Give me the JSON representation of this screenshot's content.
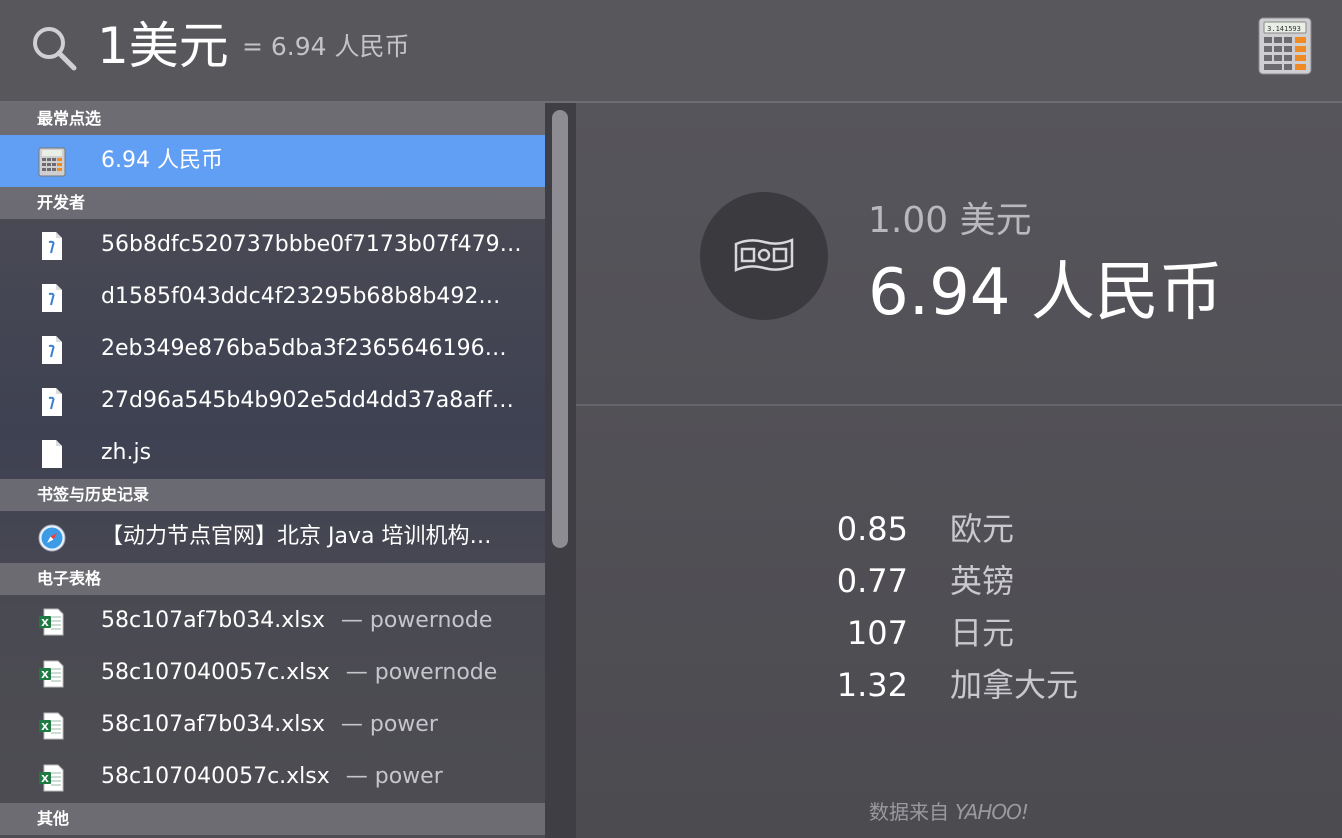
{
  "search": {
    "query": "1美元",
    "inline_result": "= 6.94 人民币"
  },
  "sections": [
    {
      "title": "最常点选",
      "items": [
        {
          "label": "6.94 人民币",
          "icon": "calculator-icon",
          "selected": true
        }
      ]
    },
    {
      "title": "开发者",
      "items": [
        {
          "label": "56b8dfc520737bbbe0f7173b07f479…",
          "icon": "java-file-icon"
        },
        {
          "label": "d1585f043ddc4f23295b68b8b492…",
          "icon": "java-file-icon"
        },
        {
          "label": "2eb349e876ba5dba3f2365646196…",
          "icon": "java-file-icon"
        },
        {
          "label": "27d96a545b4b902e5dd4dd37a8aff…",
          "icon": "java-file-icon"
        },
        {
          "label": "zh.js",
          "icon": "document-icon"
        }
      ]
    },
    {
      "title": "书签与历史记录",
      "items": [
        {
          "label": "【动力节点官网】北京 Java 培训机构…",
          "icon": "safari-icon"
        }
      ]
    },
    {
      "title": "电子表格",
      "items": [
        {
          "label": "58c107af7b034.xlsx",
          "sub": "— powernode",
          "icon": "excel-icon"
        },
        {
          "label": "58c107040057c.xlsx",
          "sub": "— powernode",
          "icon": "excel-icon"
        },
        {
          "label": "58c107af7b034.xlsx",
          "sub": "— power",
          "icon": "excel-icon"
        },
        {
          "label": "58c107040057c.xlsx",
          "sub": "— power",
          "icon": "excel-icon"
        }
      ]
    },
    {
      "title": "其他",
      "items": []
    }
  ],
  "detail": {
    "from": "1.00 美元",
    "to": "6.94 人民币",
    "rates": [
      {
        "value": "0.85",
        "currency": "欧元"
      },
      {
        "value": "0.77",
        "currency": "英镑"
      },
      {
        "value": "107",
        "currency": "日元"
      },
      {
        "value": "1.32",
        "currency": "加拿大元"
      }
    ],
    "source_prefix": "数据来自",
    "source_brand": "YAHOO!"
  },
  "colors": {
    "selected_row": "#619ff5",
    "excel_green": "#1f7a43",
    "calculator_orange": "#f08a24"
  }
}
